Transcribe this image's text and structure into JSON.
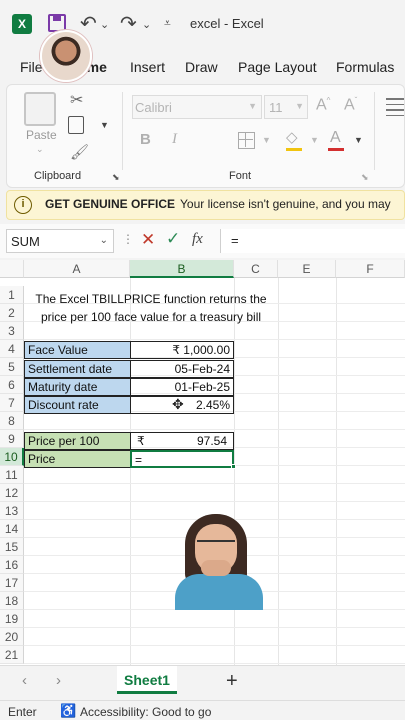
{
  "titlebar": {
    "doc_title": "excel  -  Excel",
    "logo": "X",
    "icons": [
      "excel-logo-icon",
      "save-icon",
      "undo-icon",
      "redo-icon",
      "customize-qat-icon"
    ]
  },
  "tabs": [
    "File",
    "Home",
    "Insert",
    "Draw",
    "Page Layout",
    "Formulas"
  ],
  "active_tab": "Home",
  "ribbon": {
    "paste_label": "Paste",
    "font_name": "Calibri",
    "font_size": "11",
    "clipboard_label": "Clipboard",
    "font_label": "Font"
  },
  "banner": {
    "title": "GET GENUINE OFFICE",
    "message": "Your license isn't genuine, and you may"
  },
  "formula_bar": {
    "name_box": "SUM",
    "formula": "="
  },
  "columns": [
    "A",
    "B",
    "C",
    "E",
    "F"
  ],
  "selected_column": "B",
  "rows": [
    "1",
    "2",
    "3",
    "4",
    "5",
    "6",
    "7",
    "8",
    "9",
    "10",
    "11",
    "12",
    "13",
    "14",
    "15",
    "16",
    "17",
    "18",
    "19",
    "20",
    "21"
  ],
  "selected_row": "10",
  "description": "The Excel TBILLPRICE  function returns the price per 100 face value for a treasury bill",
  "inputs": [
    {
      "label": "Face Value",
      "value": "₹ 1,000.00"
    },
    {
      "label": "Settlement date",
      "value": "05-Feb-24"
    },
    {
      "label": "Maturity date",
      "value": "01-Feb-25"
    },
    {
      "label": "Discount rate",
      "value": "2.45%"
    }
  ],
  "outputs": [
    {
      "label": "Price per 100",
      "currency": "₹",
      "value": "97.54"
    },
    {
      "label": "Price",
      "value": "="
    }
  ],
  "sheet_tab": "Sheet1",
  "status": {
    "mode": "Enter",
    "accessibility": "Accessibility: Good to go"
  },
  "colors": {
    "excel_green": "#107c41",
    "input_fill": "#bdd7ee",
    "output_fill": "#c6e0b4",
    "banner_fill": "#fcf5d4"
  }
}
